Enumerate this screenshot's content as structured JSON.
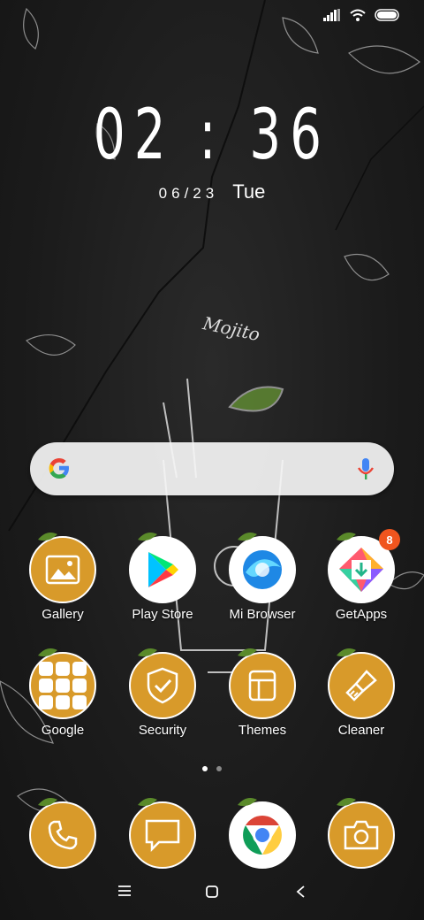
{
  "lockscreen": {
    "time": "02 : 36",
    "date": "06/23",
    "weekday": "Tue"
  },
  "wallpaper": {
    "caption": "Mojito"
  },
  "search": {
    "provider_icon": "google-g-icon",
    "mic_icon": "mic-icon"
  },
  "apps": {
    "row1": [
      {
        "label": "Gallery",
        "icon": "gallery-icon"
      },
      {
        "label": "Play Store",
        "icon": "play-store-icon"
      },
      {
        "label": "Mi Browser",
        "icon": "mi-browser-icon"
      },
      {
        "label": "GetApps",
        "icon": "getapps-icon",
        "badge": "8"
      }
    ],
    "row2": [
      {
        "label": "Google",
        "icon": "google-folder-icon"
      },
      {
        "label": "Security",
        "icon": "security-icon"
      },
      {
        "label": "Themes",
        "icon": "themes-icon"
      },
      {
        "label": "Cleaner",
        "icon": "cleaner-icon"
      }
    ],
    "dock": [
      {
        "icon": "phone-icon"
      },
      {
        "icon": "messages-icon"
      },
      {
        "icon": "chrome-icon"
      },
      {
        "icon": "camera-icon"
      }
    ]
  },
  "pager": {
    "pages": 2,
    "current": 1
  },
  "colors": {
    "icon_orange": "#d89a2a",
    "badge": "#f0551e"
  }
}
